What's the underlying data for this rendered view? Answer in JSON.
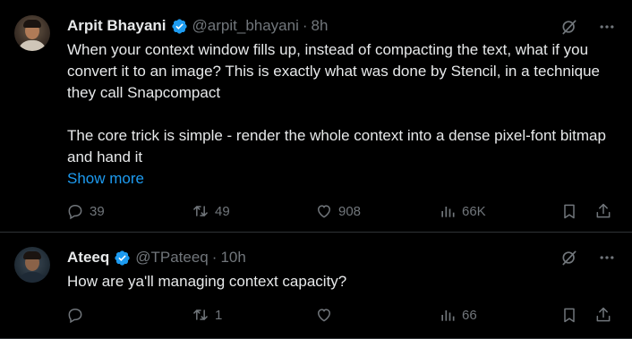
{
  "tweets": [
    {
      "author_name": "Arpit Bhayani",
      "handle": "@arpit_bhayani",
      "separator": "·",
      "time": "8h",
      "text_para1": "When your context window fills up, instead of compacting the text, what if you convert it to an image? This is exactly what was done by Stencil, in a technique they call Snapcompact",
      "text_para2": "The core trick is simple - render the whole context into a dense pixel-font bitmap and hand it",
      "show_more": "Show more",
      "replies": "39",
      "reposts": "49",
      "likes": "908",
      "views": "66K"
    },
    {
      "author_name": "Ateeq",
      "handle": "@TPateeq",
      "separator": "·",
      "time": "10h",
      "text": "How are ya'll managing context capacity?",
      "replies": "",
      "reposts": "1",
      "likes": "",
      "views": "66"
    }
  ],
  "icons": {
    "verified": "verified-badge-icon",
    "grok": "grok-icon",
    "more": "more-options-icon",
    "reply": "reply-icon",
    "repost": "repost-icon",
    "like": "like-icon",
    "views": "views-icon",
    "bookmark": "bookmark-icon",
    "share": "share-icon"
  },
  "colors": {
    "background": "#000000",
    "text": "#e7e9ea",
    "muted": "#71767b",
    "accent": "#1d9bf0",
    "divider": "#2f3336"
  }
}
